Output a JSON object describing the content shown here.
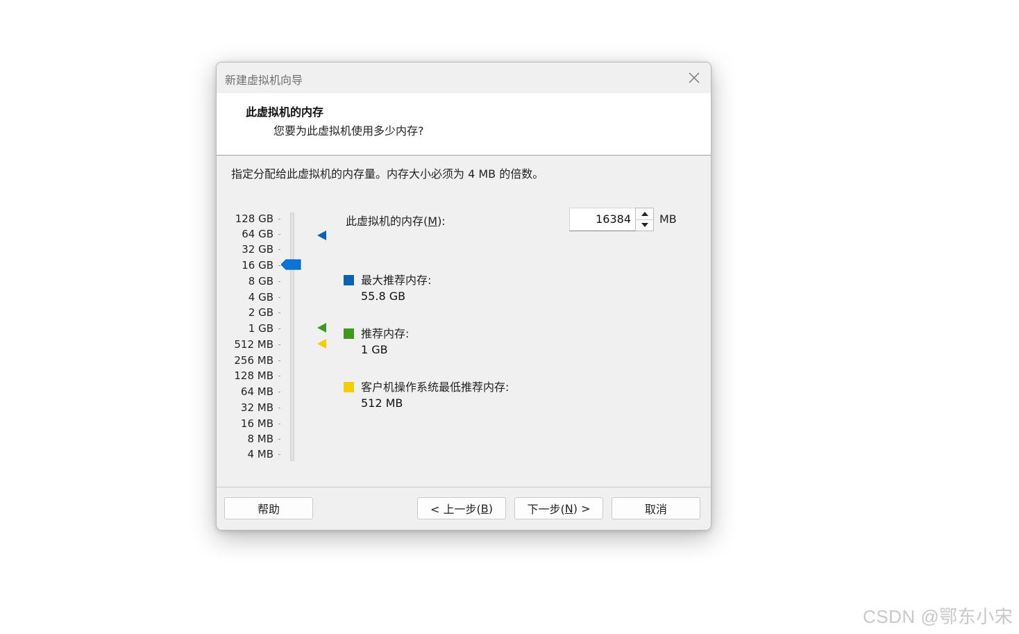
{
  "window": {
    "title": "新建虚拟机向导"
  },
  "header": {
    "title": "此虚拟机的内存",
    "subtitle": "您要为此虚拟机使用多少内存?"
  },
  "instruction": "指定分配给此虚拟机的内存量。内存大小必须为 4 MB 的倍数。",
  "memory_scale": {
    "ticks": [
      "128 GB",
      "64 GB",
      "32 GB",
      "16 GB",
      "8 GB",
      "4 GB",
      "2 GB",
      "1 GB",
      "512 MB",
      "256 MB",
      "128 MB",
      "64 MB",
      "32 MB",
      "16 MB",
      "8 MB",
      "4 MB"
    ],
    "selected": "16 GB"
  },
  "memory_field": {
    "label_prefix": "此虚拟机的内存(",
    "label_hotkey": "M",
    "label_suffix": "):",
    "value": "16384",
    "unit": "MB"
  },
  "legend": [
    {
      "label": "最大推荐内存:",
      "value": "55.8 GB",
      "color": "#0b62b2"
    },
    {
      "label": "推荐内存:",
      "value": "1 GB",
      "color": "#3f9a1c"
    },
    {
      "label": "客户机操作系统最低推荐内存:",
      "value": "512 MB",
      "color": "#f2cf00"
    }
  ],
  "buttons": {
    "help": "帮助",
    "back_prefix": "< 上一步(",
    "back_hotkey": "B",
    "back_suffix": ")",
    "next_prefix": "下一步(",
    "next_hotkey": "N",
    "next_suffix": ") >",
    "cancel": "取消"
  },
  "watermark": "CSDN @鄂东小宋",
  "colors": {
    "thumb": "#0a74da",
    "max_marker": "#0b62b2",
    "recommended_marker": "#3f9a1c",
    "min_marker": "#f2cf00"
  }
}
